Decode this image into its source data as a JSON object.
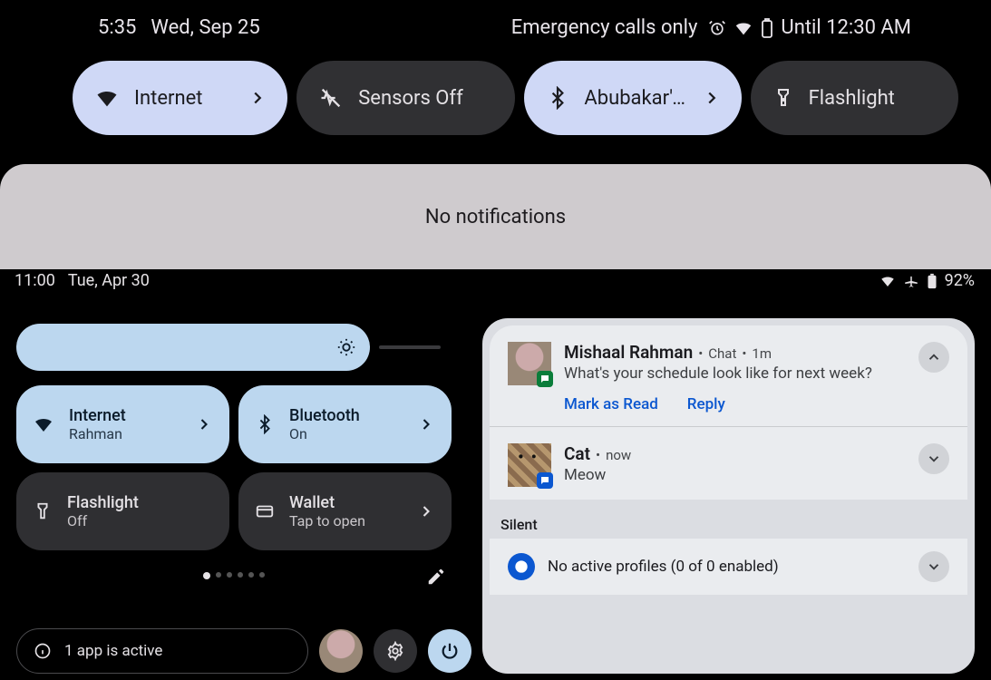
{
  "top": {
    "status": {
      "time": "5:35",
      "date": "Wed, Sep 25",
      "emergency": "Emergency calls only",
      "until": "Until 12:30 AM"
    },
    "tiles": {
      "internet": "Internet",
      "sensors": "Sensors Off",
      "bluetooth": "Abubakar's..",
      "flashlight": "Flashlight"
    },
    "no_notifications": "No notifications"
  },
  "bottom": {
    "status": {
      "time": "11:00",
      "date": "Tue, Apr 30",
      "battery": "92%"
    },
    "tiles": {
      "internet": {
        "title": "Internet",
        "sub": "Rahman"
      },
      "bluetooth": {
        "title": "Bluetooth",
        "sub": "On"
      },
      "flashlight": {
        "title": "Flashlight",
        "sub": "Off"
      },
      "wallet": {
        "title": "Wallet",
        "sub": "Tap to open"
      }
    },
    "active_apps": "1 app is active"
  },
  "notifications": {
    "chat": {
      "sender": "Mishaal Rahman",
      "source": "Chat",
      "time": "1m",
      "message": "What's your schedule look like for next week?",
      "mark_read": "Mark as Read",
      "reply": "Reply"
    },
    "cat": {
      "sender": "Cat",
      "time": "now",
      "message": "Meow"
    },
    "silent_label": "Silent",
    "profiles": "No active profiles (0 of 0 enabled)"
  }
}
